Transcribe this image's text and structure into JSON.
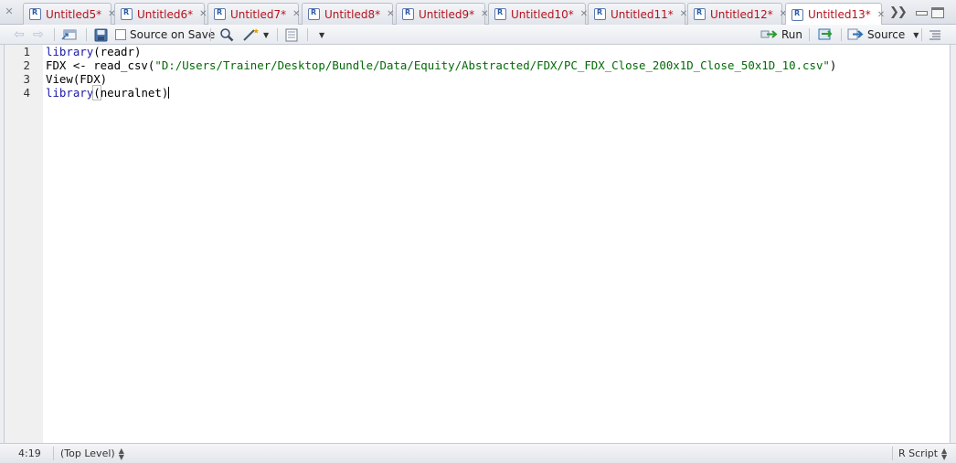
{
  "tabs": [
    {
      "label": "Untitled5*"
    },
    {
      "label": "Untitled6*"
    },
    {
      "label": "Untitled7*"
    },
    {
      "label": "Untitled8*"
    },
    {
      "label": "Untitled9*"
    },
    {
      "label": "Untitled10*"
    },
    {
      "label": "Untitled11*"
    },
    {
      "label": "Untitled12*"
    },
    {
      "label": "Untitled13*"
    }
  ],
  "toolbar": {
    "source_on_save_label": "Source on Save",
    "run_label": "Run",
    "source_label": "Source"
  },
  "editor": {
    "lines": [
      {
        "num": "1",
        "kw": "library",
        "rest": "(readr)"
      },
      {
        "num": "2",
        "pre": "FDX <- read_csv(",
        "str": "\"D:/Users/Trainer/Desktop/Bundle/Data/Equity/Abstracted/FDX/PC_FDX_Close_200x1D_Close_50x1D_10.csv\"",
        "post": ")"
      },
      {
        "num": "3",
        "text": "View(FDX)"
      },
      {
        "num": "4",
        "kw": "library",
        "paren": "(",
        "rest": "neuralnet)"
      }
    ]
  },
  "status": {
    "position": "4:19",
    "scope": "(Top Level)",
    "file_type": "R Script"
  }
}
